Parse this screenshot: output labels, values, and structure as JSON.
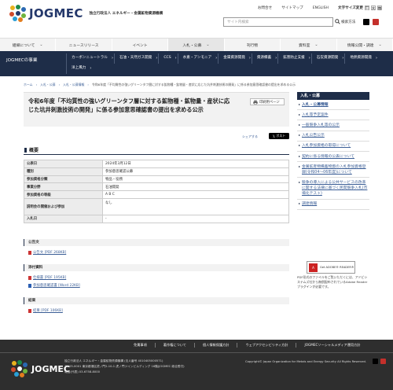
{
  "header": {
    "logo_text": "JOGMEC",
    "logo_sub": "独立行政法人 エネルギー・金属鉱物資源機構",
    "top_links": [
      "お問合せ",
      "サイトマップ",
      "ENGLISH"
    ],
    "font_size_label": "文字サイズ変更",
    "font_sizes": [
      "標",
      "大",
      "特"
    ],
    "search_placeholder": "サイト内検索",
    "search_label": "検索方法"
  },
  "gnav": [
    {
      "label": "組織について",
      "active": false
    },
    {
      "label": "ニュースリリース",
      "active": false
    },
    {
      "label": "イベント",
      "active": false
    },
    {
      "label": "入札・公募",
      "active": true
    },
    {
      "label": "刊行物",
      "active": false
    },
    {
      "label": "資料室",
      "active": false
    },
    {
      "label": "情報公開・調達",
      "active": false
    }
  ],
  "subnav": {
    "title": "JOGMECの事業",
    "links": [
      "カーボンニュートラル",
      "石油・天然ガス開発",
      "CCS",
      "水素・アンモニア",
      "金属資源開発",
      "資源備蓄",
      "鉱害防止支援",
      "石炭資源開発",
      "地熱資源開発",
      "洋上風力"
    ]
  },
  "breadcrumb": [
    "ホーム",
    "入札・公募",
    "入札・公募情報",
    "令和6年度「不均質性の強いグリーンタフ層に対する鉱物種・鉱物量・産状に応じた坑井刺激技術の開発」に係る参加意思確認書の提出を求める公示"
  ],
  "main": {
    "title": "令和6年度「不均質性の強いグリーンタフ層に対する鉱物種・鉱物量・産状に応じた坑井刺激技術の開発」に係る参加意思確認書の提出を求める公示",
    "print_label": "印刷用ページ",
    "share_label": "シェアする",
    "tweet_label": "ポスト",
    "overview_heading": "概要",
    "overview": [
      {
        "k": "公表日",
        "v": "2024年3月12日"
      },
      {
        "k": "種別",
        "v": "参加意思確認公募"
      },
      {
        "k": "参加資格分類",
        "v": "物品・役務"
      },
      {
        "k": "事業分野",
        "v": "石油開発"
      },
      {
        "k": "参加資格の等級",
        "v": "A B C"
      },
      {
        "k": "説明会の開催および参加",
        "v": "なし"
      },
      {
        "k": "入札日",
        "v": "-"
      }
    ],
    "sections": [
      {
        "heading": "公告文",
        "files": [
          {
            "type": "pdf",
            "label": "公告文 [PDF 268KB]"
          }
        ]
      },
      {
        "heading": "添付資料",
        "files": [
          {
            "type": "pdf",
            "label": "仕様書 [PDF 195KB]"
          },
          {
            "type": "word",
            "label": "参加意思確認書 [Word 22KB]"
          }
        ]
      },
      {
        "heading": "結果",
        "files": [
          {
            "type": "pdf",
            "label": "結果 [PDF 106KB]"
          }
        ]
      }
    ]
  },
  "sidebar": {
    "heading": "入札・公募",
    "items": [
      {
        "label": "入札・公募情報",
        "active": true
      },
      {
        "label": "入札等予定案件",
        "active": false
      },
      {
        "label": "一般競争入札等の公示",
        "active": false
      },
      {
        "label": "入札公告公示",
        "active": false
      },
      {
        "label": "入札参加資格の取得について",
        "active": false
      },
      {
        "label": "契約に係る情報の公表について",
        "active": false
      },
      {
        "label": "金属鉱産物備蓄物資の入札参加資格登録(令和04〜06年度)について",
        "active": false
      },
      {
        "label": "競争の導入による公共サービスの改革に関する法律に基づく民間競争入札(市場化テスト)",
        "active": false
      },
      {
        "label": "調達情報",
        "active": false
      }
    ],
    "adobe_label": "Get ADOBE® READER®",
    "adobe_note": "PDF形式のファイルをご覧いただくには、アドビシステムズ社から無償配布されているAdobe Readerプラグインが必要です。"
  },
  "footer": {
    "links": [
      "免責事項",
      "著作権について",
      "個人情報保護方針",
      "ウェブアクセシビリティ方針",
      "JOGMECソーシャルメディア運用方針"
    ],
    "logo_text": "JOGMEC",
    "address": [
      "独立行政法人 エネルギー・金属鉱物資源機構 (法人番号 4010405000571)",
      "〒105-0001 東京都港区虎ノ門2-10-1 虎ノ門ツインビルディング 16階(JOGMEC 総合受付)",
      "電話(代表) 03-6758-8000"
    ],
    "copyright": "Copyright© Japan Organization for Metals and Energy Security All Rights Reserved."
  },
  "colors": {
    "navy": "#1e2d48",
    "link": "#3b5e96"
  }
}
